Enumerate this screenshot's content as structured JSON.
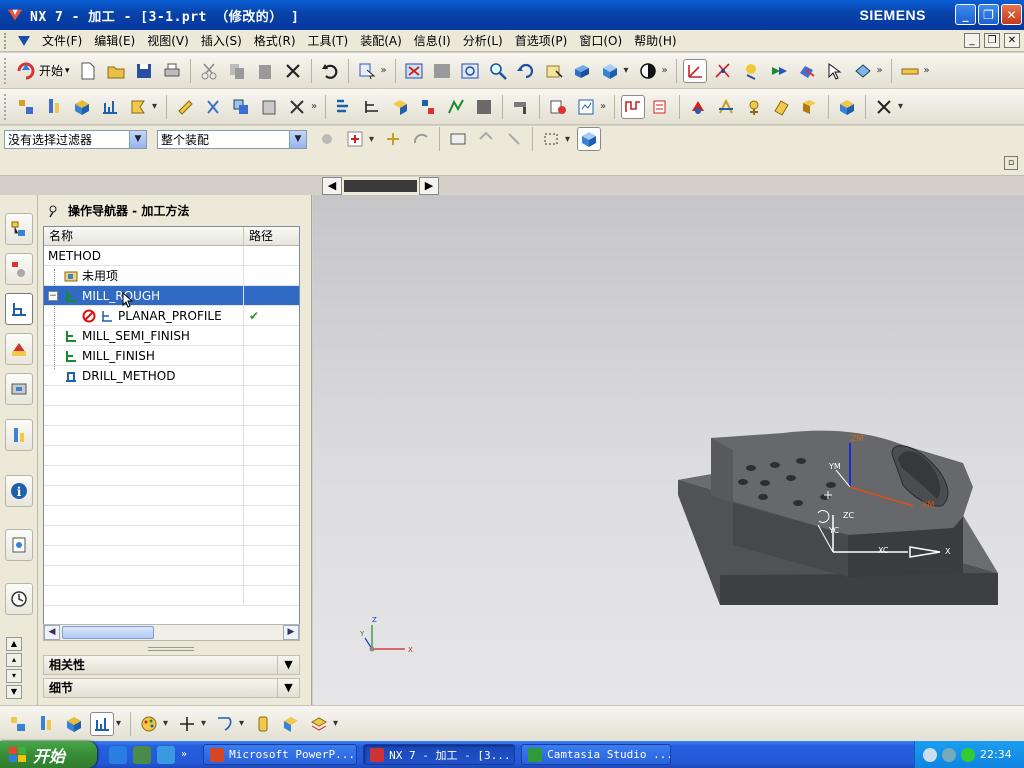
{
  "window": {
    "title": "NX 7 - 加工 - [3-1.prt （修改的） ]",
    "brand": "SIEMENS",
    "minimize": "_",
    "restore": "❐",
    "close": "✕"
  },
  "menu": {
    "items": [
      "文件(F)",
      "编辑(E)",
      "视图(V)",
      "插入(S)",
      "格式(R)",
      "工具(T)",
      "装配(A)",
      "信息(I)",
      "分析(L)",
      "首选项(P)",
      "窗口(O)",
      "帮助(H)"
    ]
  },
  "toolbar": {
    "start_label": "开始",
    "filter_value": "没有选择过滤器",
    "assembly_value": "整个装配"
  },
  "navigator": {
    "title": "操作导航器 - 加工方法",
    "col_name": "名称",
    "col_path": "路径",
    "rows": [
      {
        "label": "METHOD"
      },
      {
        "label": "未用项"
      },
      {
        "label": "MILL_ROUGH"
      },
      {
        "label": "PLANAR_PROFILE",
        "status": "✔"
      },
      {
        "label": "MILL_SEMI_FINISH"
      },
      {
        "label": "MILL_FINISH"
      },
      {
        "label": "DRILL_METHOD"
      }
    ],
    "collapse_glyph": "−"
  },
  "sections": {
    "dependencies": "相关性",
    "details": "细节"
  },
  "viewport": {
    "axis_labels": {
      "zm": "ZM",
      "ym": "YM",
      "xm": "XM",
      "zc": "ZC",
      "yc": "YC",
      "xc": "XC",
      "x_handle": "X",
      "triad_z": "Z",
      "triad_y": "Y",
      "triad_x": "X"
    },
    "part_color": "#5a5c5e"
  },
  "taskbar": {
    "start": "开始",
    "tasks": [
      {
        "label": "Microsoft PowerP..."
      },
      {
        "label": "NX 7 - 加工 - [3..."
      },
      {
        "label": "Camtasia Studio ..."
      }
    ],
    "clock": "22:34"
  }
}
